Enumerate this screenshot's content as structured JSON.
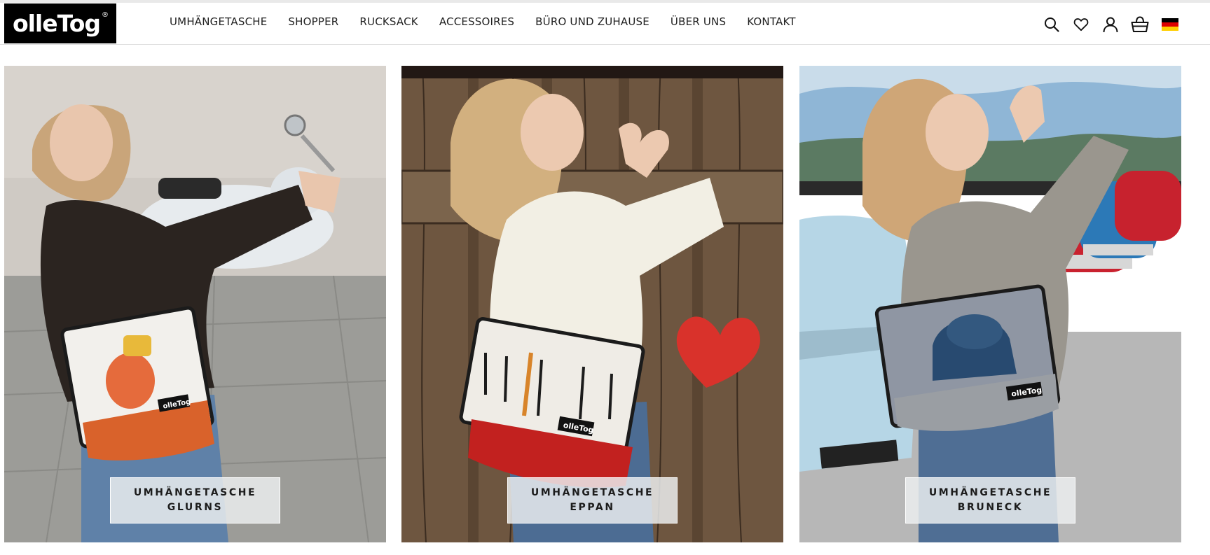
{
  "brand": {
    "logo_text": "olleTog",
    "registered_mark": "®"
  },
  "nav": {
    "items": [
      {
        "label": "UMHÄNGETASCHE"
      },
      {
        "label": "SHOPPER"
      },
      {
        "label": "RUCKSACK"
      },
      {
        "label": "ACCESSOIRES"
      },
      {
        "label": "BÜRO UND ZUHAUSE"
      },
      {
        "label": "ÜBER UNS"
      },
      {
        "label": "KONTAKT"
      }
    ]
  },
  "header_icons": [
    "search-icon",
    "heart-icon",
    "account-icon",
    "basket-icon",
    "german-flag-icon"
  ],
  "products": [
    {
      "line1": "UMHÄNGETASCHE",
      "line2": "GLURNS",
      "bag_accent": "#d9622b",
      "bag_logo": "olleTog"
    },
    {
      "line1": "UMHÄNGETASCHE",
      "line2": "EPPAN",
      "bag_accent": "#c2211f",
      "bag_logo": "olleTog"
    },
    {
      "line1": "UMHÄNGETASCHE",
      "line2": "BRUNECK",
      "bag_accent": "#9a9ea3",
      "bag_logo": "olleTog"
    }
  ],
  "colors": {
    "logo_bg": "#000000",
    "flag_black": "#000000",
    "flag_red": "#dd0000",
    "flag_gold": "#ffce00"
  }
}
